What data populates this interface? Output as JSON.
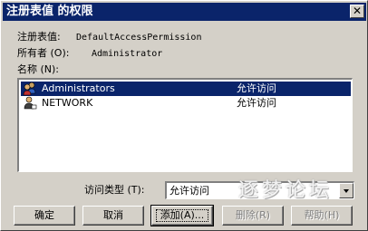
{
  "window": {
    "title": "注册表值 的权限",
    "close_glyph": "✕"
  },
  "info": {
    "registry_value_label": "注册表值:",
    "registry_value": "DefaultAccessPermission",
    "owner_label": "所有者 (O):",
    "owner": "Administrator",
    "names_label": "名称 (N):"
  },
  "permissions_list": {
    "rows": [
      {
        "name": "Administrators",
        "permission": "允许访问",
        "icon": "group-icon",
        "selected": true
      },
      {
        "name": "NETWORK",
        "permission": "允许访问",
        "icon": "user-icon",
        "selected": false
      }
    ]
  },
  "access_type": {
    "label": "访问类型 (T):",
    "value": "允许访问"
  },
  "buttons": {
    "ok": "确定",
    "cancel": "取消",
    "add": "添加(A)...",
    "remove": "删除(R)",
    "help": "帮助(H)"
  },
  "watermark": "逐梦论坛",
  "colors": {
    "titlebar": "#0a246a",
    "selection": "#0a246a",
    "face": "#d4d0c8"
  }
}
